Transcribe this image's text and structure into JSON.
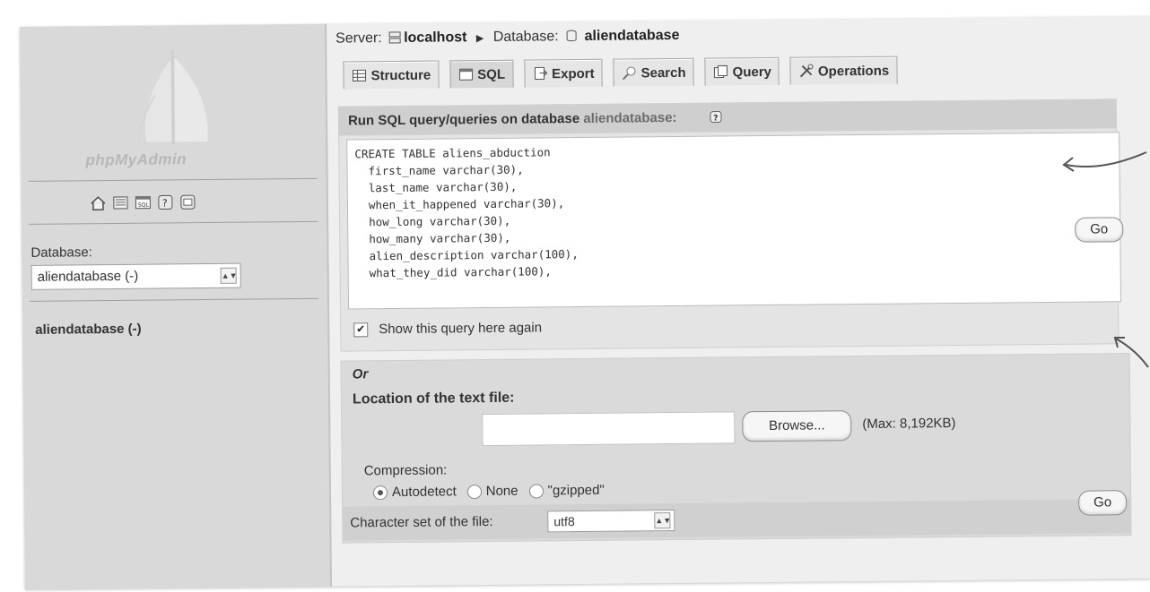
{
  "sidebar": {
    "logo_text": "phpMyAdmin",
    "database_label": "Database:",
    "database_select": "aliendatabase (-)",
    "database_link": "aliendatabase (-)",
    "icons": [
      "home-icon",
      "query-window-icon",
      "sql-icon",
      "help-icon",
      "docs-icon"
    ]
  },
  "breadcrumb": {
    "server_label": "Server:",
    "server_name": "localhost",
    "database_label": "Database:",
    "database_name": "aliendatabase"
  },
  "tabs": [
    {
      "label": "Structure",
      "icon": "structure-icon"
    },
    {
      "label": "SQL",
      "icon": "sql-icon"
    },
    {
      "label": "Export",
      "icon": "export-icon"
    },
    {
      "label": "Search",
      "icon": "search-icon"
    },
    {
      "label": "Query",
      "icon": "query-icon"
    },
    {
      "label": "Operations",
      "icon": "operations-icon"
    }
  ],
  "sql_panel": {
    "heading": "Run SQL query/queries on database",
    "heading_db": "aliendatabase:",
    "query_text": "CREATE TABLE aliens_abduction\n  first_name varchar(30),\n  last_name varchar(30),\n  when_it_happened varchar(30),\n  how_long varchar(30),\n  how_many varchar(30),\n  alien_description varchar(100),\n  what_they_did varchar(100),",
    "show_again_label": "Show this query here again",
    "show_again_checked": true,
    "go_label": "Go"
  },
  "file_panel": {
    "or_label": "Or",
    "location_label": "Location of the text file:",
    "browse_label": "Browse...",
    "max_size": "(Max: 8,192KB)",
    "compression_label": "Compression:",
    "compression_options": [
      "Autodetect",
      "None",
      "\"gzipped\""
    ],
    "compression_selected": 0,
    "charset_label": "Character set of the file:",
    "charset_value": "utf8",
    "go_label": "Go"
  }
}
